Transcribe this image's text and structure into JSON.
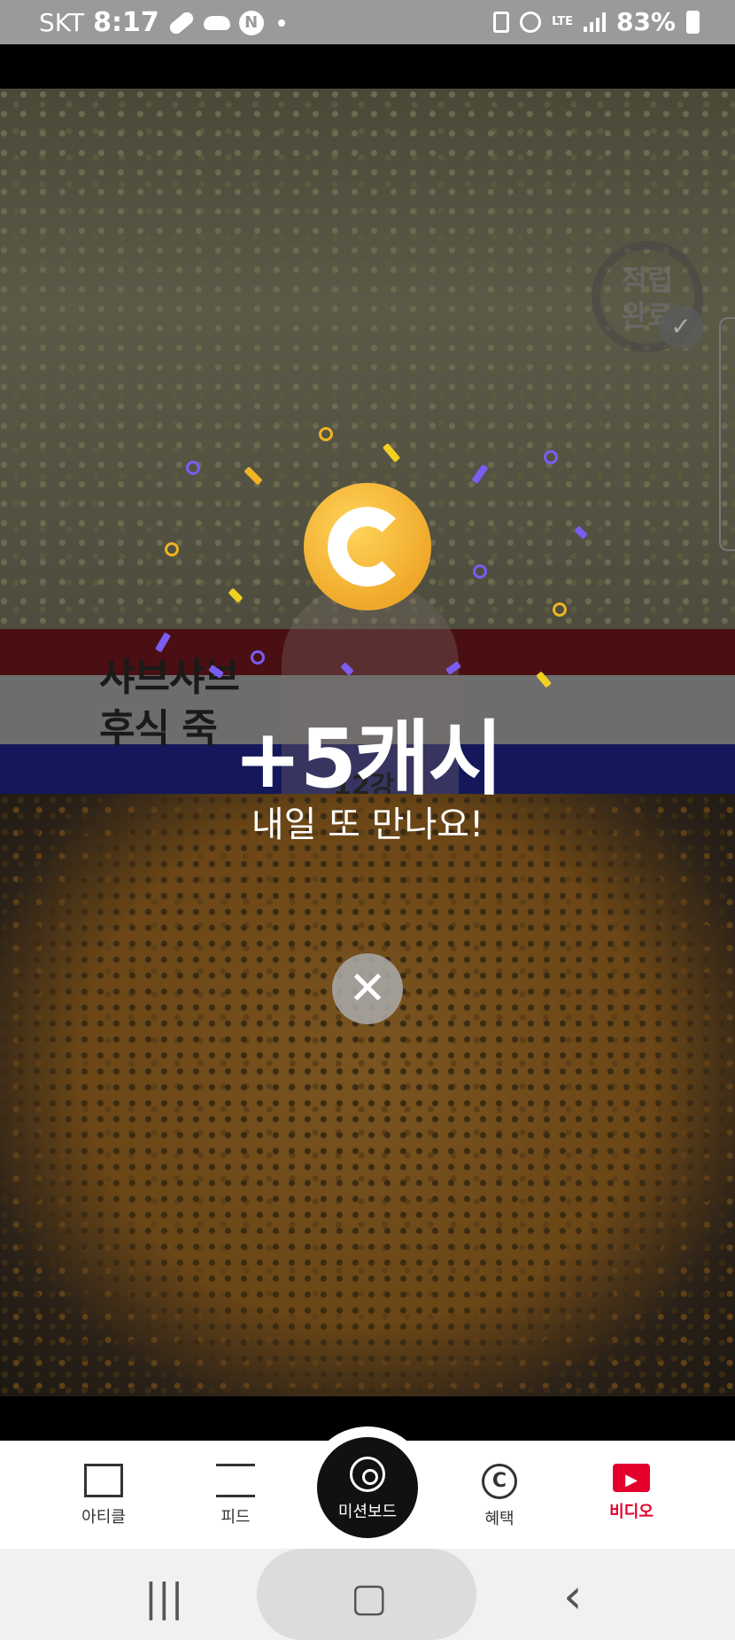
{
  "status_bar": {
    "carrier": "SKT",
    "time": "8:17",
    "network": "LTE",
    "battery": "83%",
    "notification_icons": [
      "pill-icon",
      "cloud-icon",
      "naver-n-icon",
      "dot-icon"
    ],
    "right_icons": [
      "card-icon",
      "alarm-icon",
      "lte-icon",
      "signal-icon",
      "battery-icon"
    ]
  },
  "video": {
    "thumbnail_title_line1": "샤브샤브",
    "thumbnail_title_line2": "후식 죽",
    "thumbnail_caption": "12강",
    "stamp_line1": "적립",
    "stamp_line2": "완료"
  },
  "reward": {
    "coin_icon": "cash-coin-icon",
    "amount": "+5캐시",
    "message": "내일 또 만나요!",
    "close_label": "✕"
  },
  "bottom_nav": {
    "items": [
      {
        "label": "아티클",
        "icon": "article-icon"
      },
      {
        "label": "피드",
        "icon": "feed-icon"
      },
      {
        "label": "미션보드",
        "icon": "target-icon"
      },
      {
        "label": "혜택",
        "icon": "benefit-coin-icon"
      },
      {
        "label": "비디오",
        "icon": "video-play-icon"
      }
    ],
    "active": "비디오",
    "active_color": "#e4002b"
  },
  "system_nav": {
    "recents": "|||",
    "home": "▢",
    "back": "‹"
  }
}
